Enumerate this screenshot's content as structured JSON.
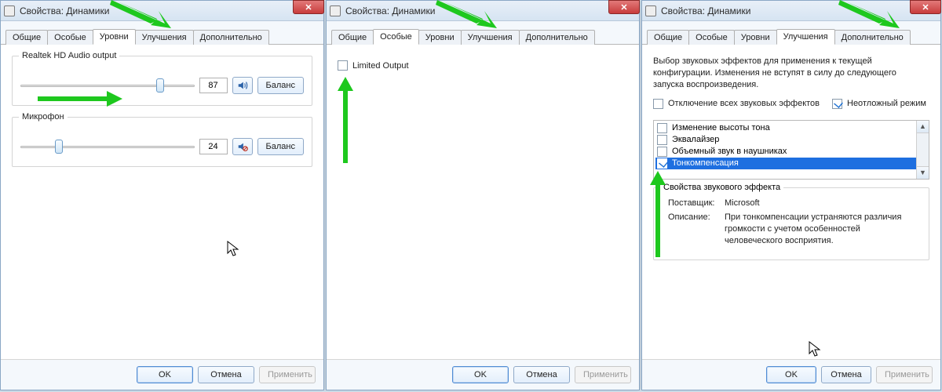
{
  "win1": {
    "title": "Свойства: Динамики",
    "tabs": [
      "Общие",
      "Особые",
      "Уровни",
      "Улучшения",
      "Дополнительно"
    ],
    "active_tab": 2,
    "group1": {
      "title": "Realtek HD Audio output",
      "value": "87",
      "balance": "Баланс"
    },
    "group2": {
      "title": "Микрофон",
      "value": "24",
      "balance": "Баланс"
    },
    "buttons": {
      "ok": "OK",
      "cancel": "Отмена",
      "apply": "Применить"
    }
  },
  "win2": {
    "title": "Свойства: Динамики",
    "tabs": [
      "Общие",
      "Особые",
      "Уровни",
      "Улучшения",
      "Дополнительно"
    ],
    "active_tab": 1,
    "checkbox_label": "Limited Output",
    "buttons": {
      "ok": "OK",
      "cancel": "Отмена",
      "apply": "Применить"
    }
  },
  "win3": {
    "title": "Свойства: Динамики",
    "tabs": [
      "Общие",
      "Особые",
      "Уровни",
      "Улучшения",
      "Дополнительно"
    ],
    "active_tab": 3,
    "intro": "Выбор звуковых эффектов для применения к текущей конфигурации. Изменения не вступят в силу до следующего запуска воспроизведения.",
    "disable_all": "Отключение всех звуковых эффектов",
    "urgent": "Неотложный режим",
    "effects": [
      {
        "label": "Изменение высоты тона",
        "checked": false,
        "selected": false
      },
      {
        "label": "Эквалайзер",
        "checked": false,
        "selected": false
      },
      {
        "label": "Объемный звук в наушниках",
        "checked": false,
        "selected": false
      },
      {
        "label": "Тонкомпенсация",
        "checked": true,
        "selected": true
      }
    ],
    "effect_group_title": "Свойства звукового эффекта",
    "provider_label": "Поставщик:",
    "provider_value": "Microsoft",
    "desc_label": "Описание:",
    "desc_value": "При тонкомпенсации устраняются различия громкости с учетом особенностей человеческого восприятия.",
    "buttons": {
      "ok": "OK",
      "cancel": "Отмена",
      "apply": "Применить"
    }
  }
}
